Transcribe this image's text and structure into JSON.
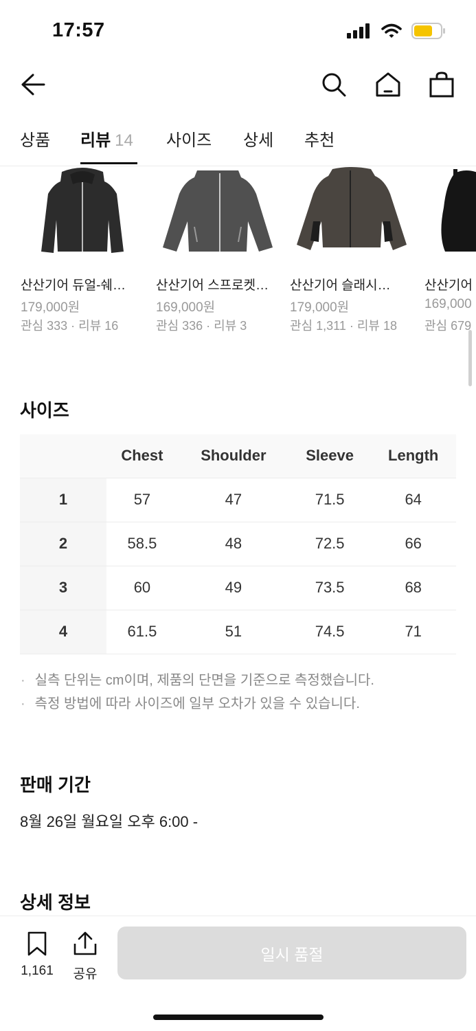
{
  "status": {
    "time": "17:57"
  },
  "tabs": [
    {
      "label": "상품"
    },
    {
      "label": "리뷰",
      "count": "14"
    },
    {
      "label": "사이즈"
    },
    {
      "label": "상세"
    },
    {
      "label": "추천"
    }
  ],
  "products": [
    {
      "name": "산산기어 듀얼-쉐…",
      "price": "179,000원",
      "meta": "관심 333 · 리뷰 16"
    },
    {
      "name": "산산기어 스프로켓…",
      "price": "169,000원",
      "meta": "관심 336 · 리뷰 3"
    },
    {
      "name": "산산기어 슬래시…",
      "price": "179,000원",
      "meta": "관심 1,311 · 리뷰 18"
    },
    {
      "name": "산산기어",
      "price": "169,000",
      "meta": "관심 679"
    }
  ],
  "size_section": {
    "title": "사이즈",
    "columns": [
      "",
      "Chest",
      "Shoulder",
      "Sleeve",
      "Length"
    ],
    "rows": [
      [
        "1",
        "57",
        "47",
        "71.5",
        "64"
      ],
      [
        "2",
        "58.5",
        "48",
        "72.5",
        "66"
      ],
      [
        "3",
        "60",
        "49",
        "73.5",
        "68"
      ],
      [
        "4",
        "61.5",
        "51",
        "74.5",
        "71"
      ]
    ],
    "notes": [
      "실측 단위는 cm이며, 제품의 단면을 기준으로 측정했습니다.",
      "측정 방법에 따라 사이즈에 일부 오차가 있을 수 있습니다."
    ]
  },
  "sale_period": {
    "title": "판매 기간",
    "value": "8월 26일 월요일 오후 6:00 -"
  },
  "detail_info": {
    "title": "상세 정보"
  },
  "bottom_bar": {
    "bookmark_count": "1,161",
    "share_label": "공유",
    "soldout_label": "일시 품절"
  },
  "colors": {
    "battery": "#f5c400",
    "button_disabled": "#dcdcdc"
  }
}
